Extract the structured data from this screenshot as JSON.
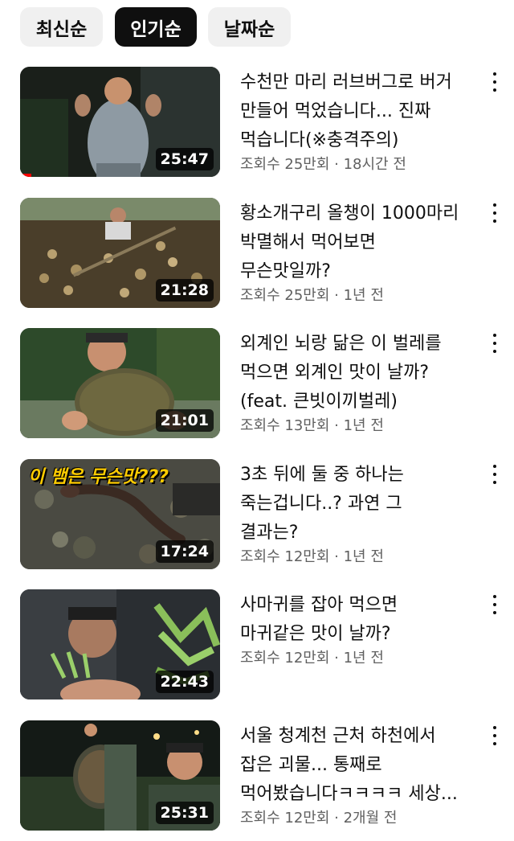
{
  "chips": [
    {
      "label": "최신순",
      "active": false
    },
    {
      "label": "인기순",
      "active": true
    },
    {
      "label": "날짜순",
      "active": false
    }
  ],
  "videos": [
    {
      "title_lines": [
        "수천만 마리 러브버그로 버거",
        "만들어 먹었습니다... 진짜",
        "먹습니다(※충격주의)"
      ],
      "meta": "조회수 25만회 · 18시간 전",
      "duration": "25:47",
      "watched": true
    },
    {
      "title_lines": [
        "황소개구리 올챙이 1000마리",
        "박멸해서 먹어보면",
        "무슨맛일까?"
      ],
      "meta": "조회수 25만회 · 1년 전",
      "duration": "21:28"
    },
    {
      "title_lines": [
        "외계인 뇌랑 닮은 이 벌레를",
        "먹으면 외계인 맛이 날까?",
        "(feat. 큰빗이끼벌레)"
      ],
      "meta": "조회수 13만회 · 1년 전",
      "duration": "21:01"
    },
    {
      "title_lines": [
        "3초 뒤에 둘 중 하나는",
        "죽는겁니다..? 과연 그",
        "결과는?"
      ],
      "meta": "조회수 12만회 · 1년 전",
      "duration": "17:24",
      "overlay": "이 뱀은 무슨맛???"
    },
    {
      "title_lines": [
        "사마귀를 잡아 먹으면",
        "마귀같은 맛이 날까?"
      ],
      "meta": "조회수 12만회 · 1년 전",
      "duration": "22:43"
    },
    {
      "title_lines": [
        "서울 청계천 근처 하천에서",
        "잡은 괴물... 통째로",
        "먹어봤습니다ㅋㅋㅋㅋ 세상..."
      ],
      "meta": "조회수 12만회 · 2개월 전",
      "duration": "25:31"
    }
  ],
  "colors": {
    "chip_active_bg": "#0f0f0f",
    "chip_bg": "#f0f0f0",
    "meta_text": "#606060",
    "progress": "#ff0000"
  },
  "icons": {
    "menu": "more-vert-icon"
  }
}
